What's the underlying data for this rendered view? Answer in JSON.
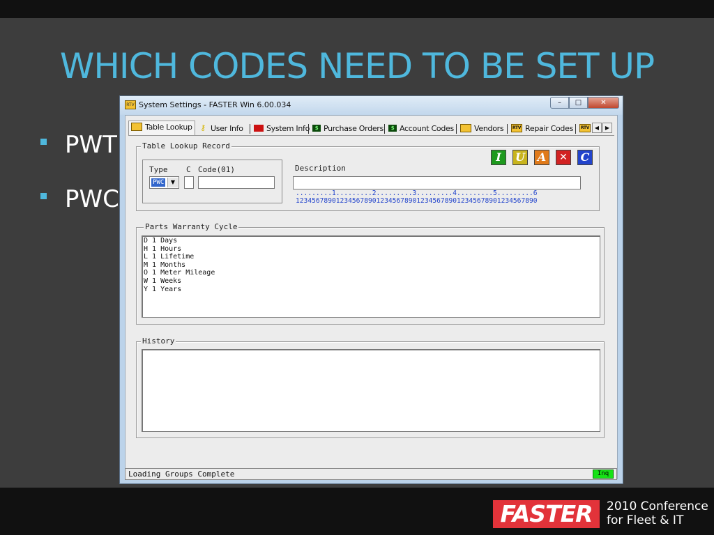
{
  "slide": {
    "title": "WHICH CODES NEED TO BE SET UP",
    "bullets": [
      "PWT",
      "PWC"
    ]
  },
  "footer": {
    "logo": "FASTER",
    "conference_line1": "2010 Conference",
    "conference_line2": "for Fleet & IT"
  },
  "window": {
    "title": "System Settings - FASTER Win 6.00.034",
    "min_glyph": "–",
    "max_glyph": "□",
    "close_glyph": "✕"
  },
  "tabs": [
    {
      "label": "Table Lookup",
      "icon": "table-lookup-icon"
    },
    {
      "label": "User Info",
      "icon": "key-icon"
    },
    {
      "label": "System Info",
      "icon": "system-info-icon"
    },
    {
      "label": "Purchase Orders",
      "icon": "dollar-icon"
    },
    {
      "label": "Account Codes",
      "icon": "dollar-icon"
    },
    {
      "label": "Vendors",
      "icon": "vendors-icon"
    },
    {
      "label": "Repair Codes",
      "icon": "rtv-icon"
    }
  ],
  "tab_scroll": {
    "left": "◀",
    "right": "▶"
  },
  "record": {
    "legend": "Table Lookup Record",
    "type_label": "Type",
    "c_label": "C",
    "code_label": "Code(01)",
    "type_value": "PWC",
    "description_label": "Description",
    "ruler_line1": ".........1.........2.........3.........4.........5.........6",
    "ruler_line2": "123456789012345678901234567890123456789012345678901234567890",
    "actions": [
      {
        "label": "I",
        "name": "insert-button",
        "color": "#1e9a1e"
      },
      {
        "label": "U",
        "name": "update-button",
        "color": "#c8b41e"
      },
      {
        "label": "A",
        "name": "add-button",
        "color": "#e07a1a"
      },
      {
        "label": "✕",
        "name": "delete-button",
        "color": "#d22222"
      },
      {
        "label": "C",
        "name": "clear-button",
        "color": "#2244cc"
      }
    ]
  },
  "warranty": {
    "legend": "Parts Warranty Cycle",
    "rows": [
      "D 1 Days",
      "H 1 Hours",
      "L 1 Lifetime",
      "M 1 Months",
      "O 1 Meter Mileage",
      "W 1 Weeks",
      "Y 1 Years"
    ]
  },
  "history": {
    "legend": "History"
  },
  "status": {
    "text": "Loading Groups Complete",
    "mode": "Inq"
  },
  "colors": {
    "title_blue": "#4fb8dd",
    "brand_red": "#e2333a",
    "status_green": "#16e216"
  }
}
